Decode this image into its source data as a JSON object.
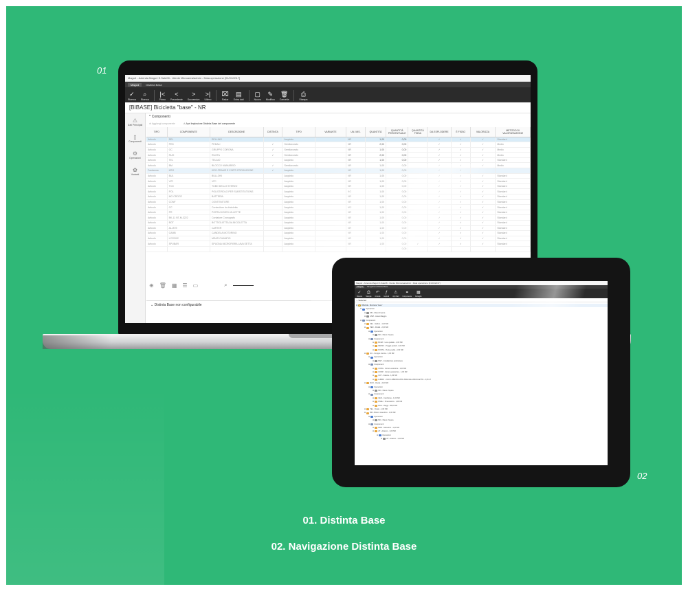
{
  "labels": {
    "num1": "01",
    "num2": "02"
  },
  "captions": {
    "cap1": "01. Distinta Base",
    "cap2": "02. Navigazione Distinta Base"
  },
  "laptop": {
    "window_title": "Mago4 - Azienda Mago4 S.Sale08 - Utente Microarea/admin - Data operazione [01/01/2017]",
    "tabs": [
      "Mago4",
      "Distinta Base"
    ],
    "toolbar": [
      {
        "icon": "check-icon",
        "glyph": "✓",
        "label": "Ricerca"
      },
      {
        "icon": "search-icon",
        "glyph": "⌕",
        "label": "Ricerca"
      },
      {
        "icon": "first-icon",
        "glyph": "|<",
        "label": "Primo"
      },
      {
        "icon": "prev-icon",
        "glyph": "<",
        "label": "Precedente"
      },
      {
        "icon": "next-icon",
        "glyph": ">",
        "label": "Successivo"
      },
      {
        "icon": "last-icon",
        "glyph": ">|",
        "label": "Ultimo"
      },
      {
        "icon": "radar-icon",
        "glyph": "⌧",
        "label": "Radar"
      },
      {
        "icon": "extra-data-icon",
        "glyph": "▤",
        "label": "Extra dati"
      },
      {
        "icon": "new-icon",
        "glyph": "▢",
        "label": "Nuovo"
      },
      {
        "icon": "edit-icon",
        "glyph": "✎",
        "label": "Modifica"
      },
      {
        "icon": "delete-icon",
        "glyph": "🗑",
        "label": "Cancella"
      },
      {
        "icon": "print-icon",
        "glyph": "⎙",
        "label": "Stampa"
      }
    ],
    "document_title": "[BIBASE] Bicicletta \"base\" - NR",
    "side_items": [
      {
        "icon": "main-data-icon",
        "glyph": "⚠",
        "label": "Dati Principali"
      },
      {
        "icon": "components-icon",
        "glyph": "▯",
        "label": "Componenti"
      },
      {
        "icon": "operations-icon",
        "glyph": "⚙",
        "label": "Operazioni"
      },
      {
        "icon": "variants-icon",
        "glyph": "✿",
        "label": "Varianti"
      }
    ],
    "section_title": "Componenti",
    "components_toolbar": [
      "Aggiungi componente",
      "Apri Implosione Distinta Base del componente"
    ],
    "columns": [
      "TIPO",
      "COMPONENTE",
      "DESCRIZIONE",
      "DISTINTA",
      "TIPO",
      "VARIANTE",
      "UN. MIS.",
      "QUANTITÀ",
      "QUANTITÀ PERCENTUALE",
      "QUANTITÀ FISSA",
      "DA ESPLODERE",
      "È FISSO",
      "VALORIZZA",
      "METODO DI VALORIZZAZIONE"
    ],
    "rows": [
      [
        "Articolo",
        "SEL",
        "SELLINO",
        "",
        "Acquisto",
        "",
        "NR",
        "1,00",
        "0,00",
        "",
        "✓",
        "✓",
        "✓",
        "Standard"
      ],
      [
        "Articolo",
        "PED",
        "PEDALI",
        "✓",
        "Semilavorato",
        "",
        "NR",
        "2,00",
        "0,00",
        "",
        "✓",
        "✓",
        "✓",
        "Medio"
      ],
      [
        "Articolo",
        "GC",
        "GRUPPO CORONA",
        "✓",
        "Semilavorato",
        "",
        "NR",
        "1,00",
        "0,00",
        "",
        "✓",
        "✓",
        "✓",
        "Medio"
      ],
      [
        "Articolo",
        "RUO",
        "RUOTA",
        "✓",
        "Semilavorato",
        "",
        "NR",
        "2,00",
        "0,00",
        "",
        "✓",
        "✓",
        "✓",
        "Medio"
      ],
      [
        "Articolo",
        "TEL",
        "TELAIO",
        "",
        "Acquisto",
        "",
        "NR",
        "1,00",
        "0,00",
        "",
        "✓",
        "✓",
        "✓",
        "Standard"
      ],
      [
        "Articolo",
        "BM",
        "BLOCCO MANUBRIO",
        "✓",
        "Semilavorato",
        "",
        "NR",
        "1,00",
        "0,00",
        "",
        "✓",
        "✓",
        "✓",
        "Medio"
      ],
      [
        "Fantasma",
        "KRO",
        "KRO-FRAME E CORTI PRODUZIONE",
        "✓",
        "Acquisto",
        "",
        "NR",
        "1,00",
        "0,00",
        "",
        "✓",
        "✓",
        "",
        ""
      ],
      [
        "Articolo",
        "BUL",
        "BULLONI",
        "",
        "Acquisto",
        "",
        "NR",
        "1,00",
        "0,00",
        "",
        "✓",
        "✓",
        "✓",
        "Standard"
      ],
      [
        "Articolo",
        "VITI",
        "VITI",
        "",
        "Acquisto",
        "",
        "NR",
        "1,00",
        "0,00",
        "",
        "✓",
        "✓",
        "✓",
        "Standard"
      ],
      [
        "Articolo",
        "TCD",
        "TUBO DELLO STERZO",
        "",
        "Acquisto",
        "",
        "NR",
        "1,00",
        "0,00",
        "",
        "✓",
        "✓",
        "✓",
        "Standard"
      ],
      [
        "Articolo",
        "POL",
        "POLISTIROLO PER SUBSTITUTIONS",
        "",
        "Acquisto",
        "",
        "KG",
        "1,00",
        "0,00",
        "",
        "✓",
        "✓",
        "✓",
        "Standard"
      ],
      [
        "Articolo",
        "MO CROCE",
        "BATTERIA",
        "",
        "Acquisto",
        "",
        "NR",
        "1,00",
        "0,00",
        "",
        "✓",
        "✓",
        "✓",
        "Standard"
      ],
      [
        "Articolo",
        "CONF",
        "CONTENITORE",
        "",
        "Acquisto",
        "",
        "NR",
        "1,00",
        "0,00",
        "",
        "✓",
        "✓",
        "✓",
        "Standard"
      ],
      [
        "Articolo",
        "CC",
        "Contenitore da bicicletta",
        "",
        "Acquisto",
        "",
        "MC",
        "1,00",
        "0,00",
        "",
        "✓",
        "✓",
        "✓",
        "Standard"
      ],
      [
        "Articolo",
        "PR",
        "PORTA DOVES-VILLETTE",
        "",
        "Acquisto",
        "",
        "NR",
        "1,00",
        "0,00",
        "",
        "✓",
        "✓",
        "✓",
        "Standard"
      ],
      [
        "Articolo",
        "BK-11 NT-M-3222",
        "Contatore Cronografo",
        "",
        "Acquisto",
        "",
        "NR",
        "1,00",
        "0,00",
        "",
        "✓",
        "✓",
        "✓",
        "Standard"
      ],
      [
        "Articolo",
        "BOT",
        "BOTTIGLIETTA DA BICICLETTA",
        "",
        "Acquisto",
        "",
        "NR",
        "1,00",
        "0,00",
        "",
        "✓",
        "✓",
        "✓",
        "Standard"
      ],
      [
        "Articolo",
        "AL-BTE",
        "CARTER",
        "",
        "Acquisto",
        "",
        "NR",
        "1,00",
        "0,00",
        "",
        "✓",
        "✓",
        "✓",
        "Standard"
      ],
      [
        "Articolo",
        "CAMB",
        "CANDELA MOTORINO",
        "",
        "Acquisto",
        "",
        "NR",
        "1,00",
        "0,00",
        "",
        "✓",
        "✓",
        "✓",
        "Standard"
      ],
      [
        "Articolo",
        "LC22002",
        "MEAR CHAMPIO",
        "",
        "Acquisto",
        "",
        "NR",
        "1,00",
        "0,00",
        "",
        "✓",
        "✓",
        "✓",
        "Standard"
      ],
      [
        "Articolo",
        "SPUBAR",
        "SPUGNA MICROFIBRA LAVA SETTA",
        "",
        "Acquisto",
        "",
        "NR",
        "1,00",
        "0,00",
        "✓",
        "✓",
        "✓",
        "✓",
        "Standard"
      ]
    ],
    "total": "0,00",
    "bottom_section": "Distinta Base non configurabile"
  },
  "tablet": {
    "window_title": "Mago4 - Azienda Mago4 S.Sale08 - Utente Microarea/admin - Data operazione [01/01/2017]",
    "tabs": [
      "Mago4",
      "Navigazione Distinta Base"
    ],
    "toolbar": [
      {
        "icon": "check-icon",
        "glyph": "✓",
        "label": "Ricerca"
      },
      {
        "icon": "print-icon",
        "glyph": "⎙",
        "label": "Stampa"
      },
      {
        "icon": "undo-icon",
        "glyph": "↶",
        "label": "Annulla"
      },
      {
        "icon": "function-icon",
        "glyph": "ƒ",
        "label": "Esplodi"
      },
      {
        "icon": "warning-icon",
        "glyph": "⚠",
        "label": "Apri Dati"
      },
      {
        "icon": "components-icon",
        "glyph": "⚭",
        "label": "Componente"
      },
      {
        "icon": "grid-icon",
        "glyph": "▦",
        "label": "Dettaglio"
      }
    ],
    "selected_label": "Selected",
    "tree": [
      {
        "level": 0,
        "kind": "root",
        "text": "BIBASE - Bicicletta \"base\""
      },
      {
        "level": 1,
        "kind": "op",
        "text": "Operazioni"
      },
      {
        "level": 2,
        "kind": "res",
        "text": "MN - Mano d'opera"
      },
      {
        "level": 2,
        "kind": "res",
        "text": "ASM - Assemblaggio"
      },
      {
        "level": 1,
        "kind": "comp",
        "text": "Componenti"
      },
      {
        "level": 2,
        "kind": "item",
        "text": "SEL - Sellino - 1,00 NR"
      },
      {
        "level": 2,
        "kind": "item",
        "text": "PED - Pedali - 2,00 NR"
      },
      {
        "level": 3,
        "kind": "op",
        "text": "Operazioni"
      },
      {
        "level": 4,
        "kind": "res",
        "text": "MO - Mano d'opera"
      },
      {
        "level": 3,
        "kind": "comp",
        "text": "Componenti"
      },
      {
        "level": 4,
        "kind": "item",
        "text": "BCHP - Leva pedale - 1,00 NR"
      },
      {
        "level": 4,
        "kind": "item",
        "text": "PEDSX - Poggia pedali - 2,00 NR"
      },
      {
        "level": 4,
        "kind": "item",
        "text": "PUNTA - Punta pedal - 2,00 NR"
      },
      {
        "level": 2,
        "kind": "item",
        "text": "GC - Gruppo corona - 1,00 NR"
      },
      {
        "level": 3,
        "kind": "op",
        "text": "Operazioni"
      },
      {
        "level": 4,
        "kind": "res",
        "text": "MST - Installazione preliminare"
      },
      {
        "level": 3,
        "kind": "comp",
        "text": "Componenti"
      },
      {
        "level": 4,
        "kind": "item",
        "text": "CORA - Corona anteriore - 1,00 NR"
      },
      {
        "level": 4,
        "kind": "item",
        "text": "CORP - Corona posteriore - 1,00 NR"
      },
      {
        "level": 4,
        "kind": "item",
        "text": "CAT - Catena - 1,00 NR"
      },
      {
        "level": 4,
        "kind": "item",
        "text": "LUBRO - OLIO LUBRIFICANTE SPECIALE BICICLETTE - 0,05 LT"
      },
      {
        "level": 2,
        "kind": "item",
        "text": "RUO - Ruota - 2,00 NR"
      },
      {
        "level": 3,
        "kind": "op",
        "text": "Operazioni"
      },
      {
        "level": 4,
        "kind": "res",
        "text": "MO - Mano d'opera"
      },
      {
        "level": 3,
        "kind": "comp",
        "text": "Componenti"
      },
      {
        "level": 4,
        "kind": "item",
        "text": "CER - Cerchione - 1,00 NR"
      },
      {
        "level": 4,
        "kind": "item",
        "text": "PNEU - Pneumatico - 1,00 NR"
      },
      {
        "level": 4,
        "kind": "item",
        "text": "RAG - Raggi - 36,00 NR"
      },
      {
        "level": 2,
        "kind": "item",
        "text": "TEL - Telaio - 1,00 NR"
      },
      {
        "level": 2,
        "kind": "item",
        "text": "BM - Blocco manubrio - 1,00 NR"
      },
      {
        "level": 3,
        "kind": "op",
        "text": "Operazioni"
      },
      {
        "level": 4,
        "kind": "res",
        "text": "MO - Mano d'opera"
      },
      {
        "level": 3,
        "kind": "comp",
        "text": "Componenti"
      },
      {
        "level": 4,
        "kind": "item",
        "text": "MAN - Manubrio - 1,00 NR"
      },
      {
        "level": 4,
        "kind": "item",
        "text": "AT - Attacco - 1,00 NR"
      },
      {
        "level": 5,
        "kind": "op",
        "text": "Operazioni"
      },
      {
        "level": 6,
        "kind": "res",
        "text": "AT - Attacco - 1,00 NR"
      }
    ]
  }
}
